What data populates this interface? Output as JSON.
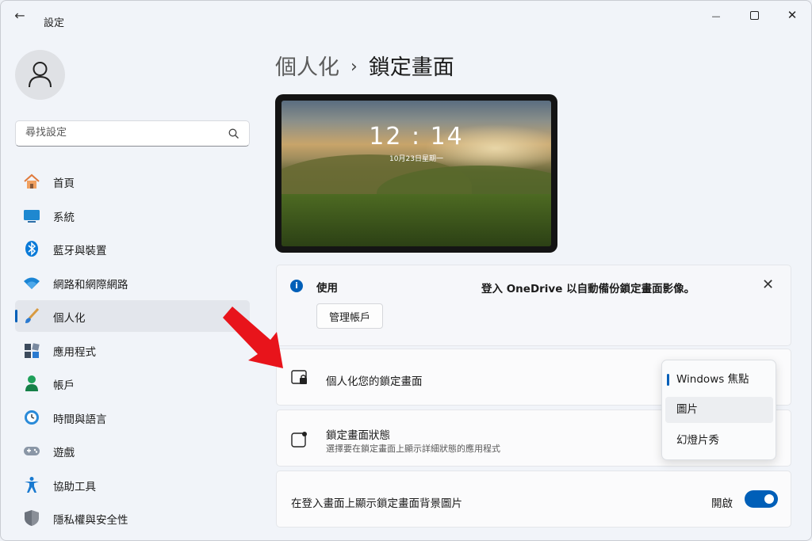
{
  "window": {
    "title": "設定",
    "back_glyph": "←",
    "minimize_glyph": "—",
    "close_glyph": "✕"
  },
  "sidebar": {
    "search_placeholder": "尋找設定",
    "items": [
      {
        "label": "首頁",
        "icon": "home-icon",
        "active": false
      },
      {
        "label": "系統",
        "icon": "display-icon",
        "active": false
      },
      {
        "label": "藍牙與裝置",
        "icon": "bluetooth-icon",
        "active": false
      },
      {
        "label": "網路和網際網路",
        "icon": "wifi-icon",
        "active": false
      },
      {
        "label": "個人化",
        "icon": "brush-icon",
        "active": true
      },
      {
        "label": "應用程式",
        "icon": "apps-icon",
        "active": false
      },
      {
        "label": "帳戶",
        "icon": "person-icon",
        "active": false
      },
      {
        "label": "時間與語言",
        "icon": "clock-globe-icon",
        "active": false
      },
      {
        "label": "遊戲",
        "icon": "gamepad-icon",
        "active": false
      },
      {
        "label": "協助工具",
        "icon": "accessibility-icon",
        "active": false
      },
      {
        "label": "隱私權與安全性",
        "icon": "shield-icon",
        "active": false
      }
    ]
  },
  "breadcrumb": {
    "parent": "個人化",
    "separator": "›",
    "current": "鎖定畫面"
  },
  "preview": {
    "time": "12 : 14",
    "date": "10月23日星期一"
  },
  "banner": {
    "info_glyph": "i",
    "title": "使用",
    "message": "登入 OneDrive 以自動備份鎖定畫面影像。",
    "close_glyph": "✕",
    "manage_button": "管理帳戶"
  },
  "rows": {
    "personalize": {
      "title": "個人化您的鎖定畫面"
    },
    "status": {
      "title": "鎖定畫面狀態",
      "subtitle": "選擇要在鎖定畫面上顯示詳細狀態的應用程式"
    },
    "signin_bg": {
      "title": "在登入畫面上顯示鎖定畫面背景圖片",
      "toggle_label": "開啟",
      "toggle_on": true
    }
  },
  "dropdown": {
    "options": [
      "Windows 焦點",
      "圖片",
      "幻燈片秀"
    ],
    "selected": "Windows 焦點",
    "hovered": "圖片"
  },
  "colors": {
    "accent": "#005fb8",
    "annotation_arrow": "#e8141b"
  }
}
